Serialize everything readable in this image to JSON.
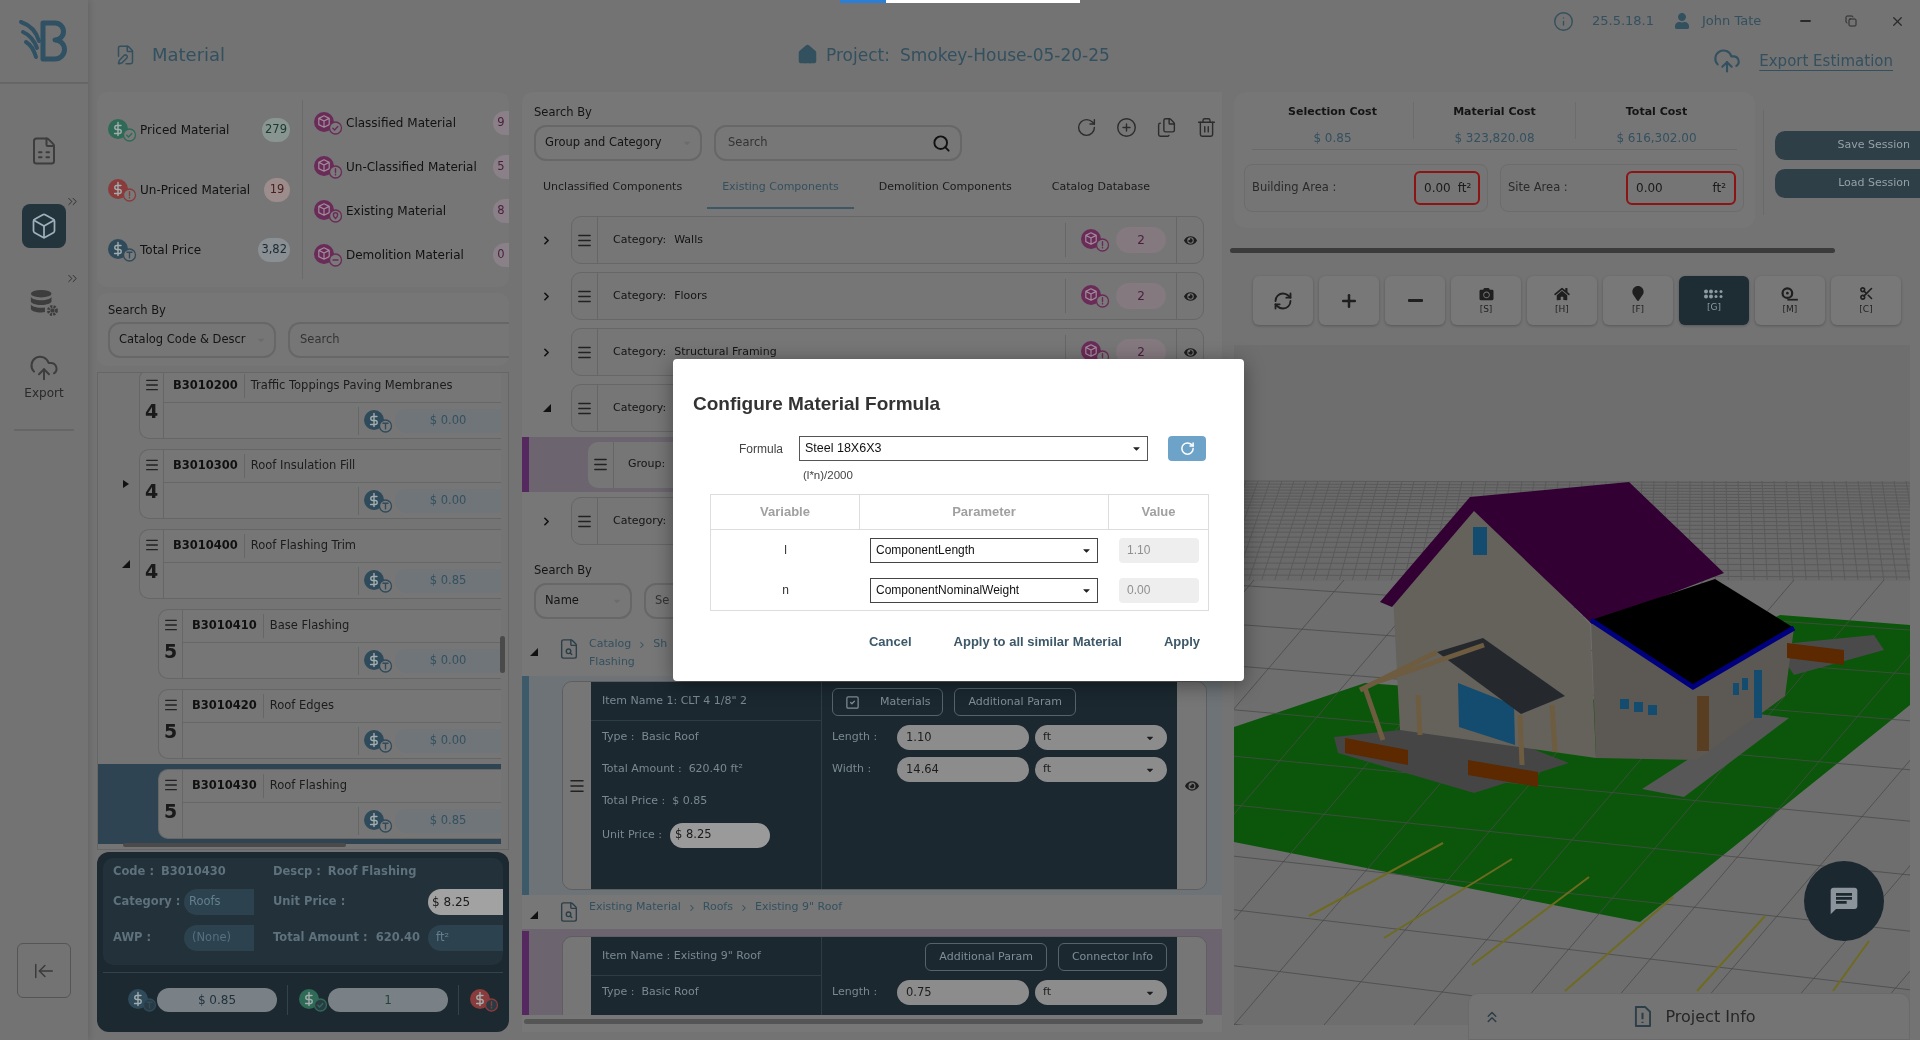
{
  "loading_bar": {
    "level": 0.19
  },
  "nav": {
    "items": [
      {
        "selected": false
      },
      {
        "selected": true,
        "expandable": true
      },
      {
        "selected": false,
        "expandable": true
      },
      {
        "selected": false,
        "label": "Export"
      }
    ]
  },
  "header": {
    "title": "Material",
    "project_label": "Project:",
    "project_name": "Smokey-House-05-20-25",
    "version": "25.5.18.1",
    "user": "John Tate",
    "export_link": "Export Estimation"
  },
  "summary": {
    "left": [
      {
        "label": "Priced Material",
        "count": "279",
        "color": "#2e6a56"
      },
      {
        "label": "Un-Priced Material",
        "count": "19",
        "color": "#8a3b3b"
      },
      {
        "label": "Total Price",
        "count": "3,82",
        "color": "#2f4a5a"
      }
    ],
    "right": [
      {
        "label": "Classified Material",
        "count": "9"
      },
      {
        "label": "Un-Classified Material",
        "count": "5"
      },
      {
        "label": "Existing Material",
        "count": "8"
      },
      {
        "label": "Demolition Material",
        "count": "0"
      }
    ]
  },
  "catalog_search": {
    "label": "Search By",
    "select": "Catalog Code & Descr",
    "placeholder": "Search"
  },
  "catalog_tree": [
    {
      "code": "B3010200",
      "description": "Traffic Toppings Paving Membranes",
      "tier": "4",
      "price": "$ 0.00",
      "selected": false
    },
    {
      "code": "B3010300",
      "description": "Roof Insulation Fill",
      "tier": "4",
      "price": "$ 0.00",
      "selected": false,
      "expanded": false
    },
    {
      "code": "B3010400",
      "description": "Roof Flashing Trim",
      "tier": "4",
      "price": "$ 0.85",
      "selected": false,
      "expanded": true,
      "children": [
        {
          "code": "B3010410",
          "description": "Base Flashing",
          "tier": "5",
          "price": "$ 0.00",
          "selected": false
        },
        {
          "code": "B3010420",
          "description": "Roof Edges",
          "tier": "5",
          "price": "$ 0.00",
          "selected": false
        },
        {
          "code": "B3010430",
          "description": "Roof Flashing",
          "tier": "5",
          "price": "$ 0.85",
          "selected": true
        }
      ]
    }
  ],
  "details": {
    "code_label": "Code :",
    "code": "B3010430",
    "descp_label": "Descp :",
    "descp": "Roof Flashing",
    "category_label": "Category :",
    "category": "Roofs",
    "awp_label": "AWP :",
    "awp_placeholder": "(None)",
    "unit_price_label": "Unit Price :",
    "unit_price": "$ 8.25",
    "total_label": "Total Amount :",
    "total": "620.40",
    "unit": "ft²",
    "footer": [
      {
        "value": "$ 0.85",
        "color": "#2f4a5a"
      },
      {
        "value": "1",
        "color": "#2e6a56"
      },
      {
        "color": "#8a3b3b"
      }
    ]
  },
  "component_search": {
    "label": "Search By",
    "select": "Group and Category",
    "placeholder": "Search"
  },
  "tabs": [
    {
      "label": "Unclassified Components",
      "selected": false
    },
    {
      "label": "Existing Components",
      "selected": true
    },
    {
      "label": "Demolition Components",
      "selected": false
    },
    {
      "label": "Catalog Database",
      "selected": false
    }
  ],
  "categories": [
    {
      "label": "Category:",
      "name": "Walls",
      "count": "2",
      "expanded": false
    },
    {
      "label": "Category:",
      "name": "Floors",
      "count": "2",
      "expanded": false
    },
    {
      "label": "Category:",
      "name": "Structural Framing",
      "count": "2",
      "expanded": false
    },
    {
      "label": "Category:",
      "expanded": true,
      "children": [
        {
          "label": "Group:"
        }
      ]
    },
    {
      "label": "Category:",
      "expanded": false
    }
  ],
  "material_search": {
    "label": "Search By",
    "select": "Name",
    "placeholder": "Se"
  },
  "material_groups": [
    {
      "expanded": true,
      "path": [
        "Catalog",
        "Sh"
      ],
      "path_more": "Flashing",
      "color": "#3d5a6b",
      "item": {
        "name": "Item Name 1: CLT 4 1/8\" 2",
        "buttons": [
          {
            "kind": "checkbox",
            "label": "Materials",
            "checked": true
          },
          {
            "kind": "plain",
            "label": "Additional Param"
          }
        ],
        "info": [
          {
            "label": "Type :",
            "value": "Basic Roof"
          },
          {
            "label": "Total Amount :",
            "value": "620.40 ft²"
          },
          {
            "label": "Total Price :",
            "value": "$ 0.85"
          }
        ],
        "unit_price_label": "Unit Price :",
        "unit_price": "$ 8.25",
        "dims": [
          {
            "label": "Length :",
            "value": "1.10",
            "unit": "ft"
          },
          {
            "label": "Width :",
            "value": "14.64",
            "unit": "ft"
          }
        ]
      }
    },
    {
      "expanded": true,
      "path": [
        "Existing Material",
        "Roofs",
        "Existing 9\" Roof"
      ],
      "color": "#55285f",
      "item": {
        "name": "Item Name : Existing 9\" Roof",
        "buttons": [
          {
            "kind": "plain",
            "label": "Additional Param"
          },
          {
            "kind": "plain",
            "label": "Connector Info"
          }
        ],
        "info": [
          {
            "label": "Type :",
            "value": "Basic Roof"
          }
        ],
        "dims": [
          {
            "label": "Length :",
            "value": "0.75",
            "unit": "ft"
          }
        ]
      }
    }
  ],
  "costs": [
    {
      "label": "Selection Cost",
      "value": "$ 0.85"
    },
    {
      "label": "Material Cost",
      "value": "$ 323,820.08"
    },
    {
      "label": "Total Cost",
      "value": "$ 616,302.00"
    }
  ],
  "areas": [
    {
      "label": "Building Area :",
      "value": "0.00",
      "unit": "ft²",
      "invalid": true
    },
    {
      "label": "Site Area :",
      "value": "0.00",
      "unit": "ft²",
      "invalid": true
    }
  ],
  "session_buttons": [
    "Save Session",
    "Load Session"
  ],
  "viewer_tools": [
    {
      "selected": false
    },
    {
      "selected": false
    },
    {
      "selected": false
    },
    {
      "shortcut": "[S]",
      "selected": false
    },
    {
      "shortcut": "[H]",
      "selected": false
    },
    {
      "shortcut": "[F]",
      "selected": false
    },
    {
      "shortcut": "[G]",
      "selected": true
    },
    {
      "shortcut": "[M]",
      "selected": false
    },
    {
      "shortcut": "[C]",
      "selected": false
    }
  ],
  "project_info": {
    "label": "Project Info"
  },
  "dialog": {
    "title": "Configure Material Formula",
    "formula_label": "Formula",
    "formula": "Steel 18X6X3",
    "expression": "(l*n)/2000",
    "columns": [
      "Variable",
      "Parameter",
      "Value"
    ],
    "rows": [
      {
        "variable": "l",
        "parameter": "ComponentLength",
        "value": "1.10",
        "disabled": true
      },
      {
        "variable": "n",
        "parameter": "ComponentNominalWeight",
        "value": "0.00",
        "disabled": true
      }
    ],
    "buttons": [
      "Cancel",
      "Apply to all similar Material",
      "Apply"
    ]
  }
}
